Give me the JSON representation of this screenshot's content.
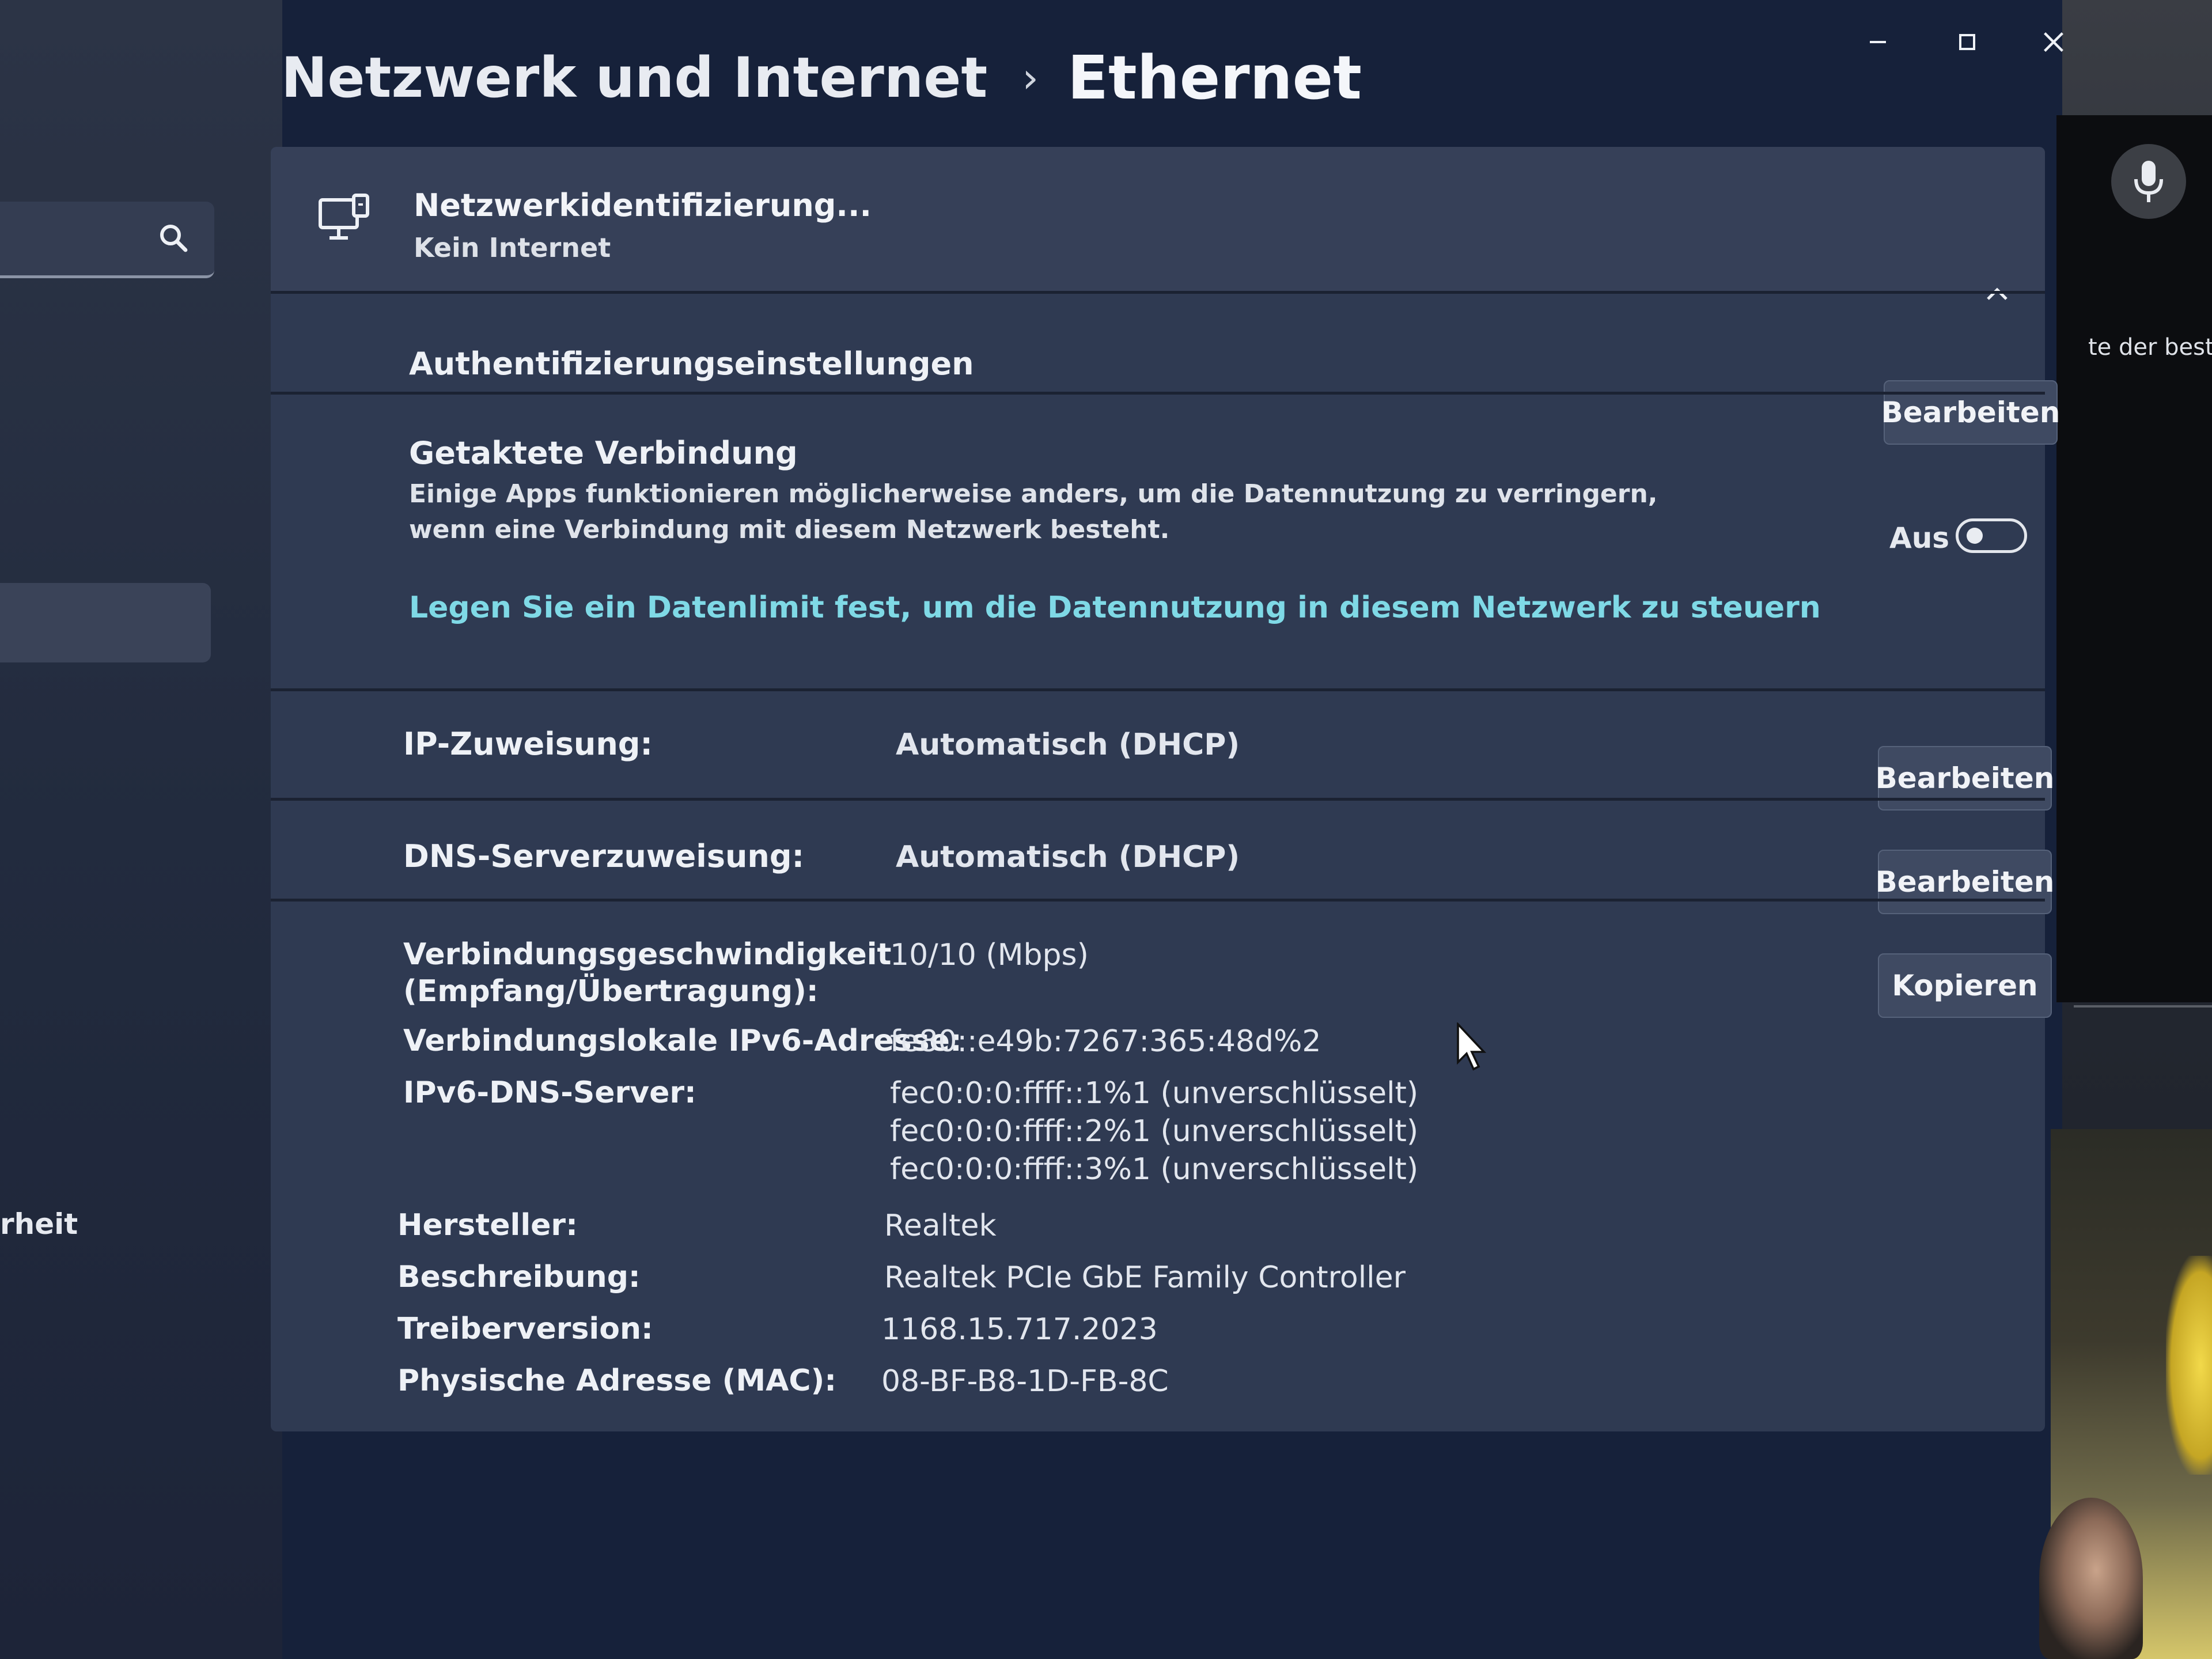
{
  "breadcrumb": {
    "parent": "Netzwerk und Internet",
    "separator": "›",
    "current": "Ethernet"
  },
  "network": {
    "name": "Netzwerkidentifizierung...",
    "status": "Kein Internet"
  },
  "auth": {
    "label": "Authentifizierungseinstellungen",
    "button": "Bearbeiten"
  },
  "metered": {
    "label": "Getaktete Verbindung",
    "description": "Einige Apps funktionieren möglicherweise anders, um die Datennutzung zu verringern, wenn eine Verbindung mit diesem Netzwerk besteht.",
    "toggle_state": "Aus",
    "toggle_on": false,
    "link": "Legen Sie ein Datenlimit fest, um die Datennutzung in diesem Netzwerk zu steuern"
  },
  "ip": {
    "label": "IP-Zuweisung:",
    "value": "Automatisch (DHCP)",
    "button": "Bearbeiten"
  },
  "dns": {
    "label": "DNS-Serverzuweisung:",
    "value": "Automatisch (DHCP)",
    "button": "Bearbeiten"
  },
  "properties": {
    "copy_button": "Kopieren",
    "speed_label_1": "Verbindungsgeschwindigkeit",
    "speed_label_2": "(Empfang/Übertragung):",
    "speed_value": "10/10 (Mbps)",
    "ipv6_label": "Verbindungslokale IPv6-Adresse:",
    "ipv6_value": "fe80::e49b:7267:365:48d%2",
    "ipv6dns_label": "IPv6-DNS-Server:",
    "ipv6dns_values": [
      "fec0:0:0:ffff::1%1 (unverschlüsselt)",
      "fec0:0:0:ffff::2%1 (unverschlüsselt)",
      "fec0:0:0:ffff::3%1 (unverschlüsselt)"
    ],
    "manufacturer_label": "Hersteller:",
    "manufacturer_value": "Realtek",
    "description_label": "Beschreibung:",
    "description_value": "Realtek PCIe GbE Family Controller",
    "driver_label": "Treiberversion:",
    "driver_value": "1168.15.717.2023",
    "mac_label": "Physische Adresse (MAC):",
    "mac_value": "08-BF-B8-1D-FB-8C"
  },
  "sidebar": {
    "partial_item": "rheit"
  },
  "background": {
    "peek_text": "te der beste"
  },
  "icons": {
    "search": "search-icon",
    "network": "network-monitor-icon",
    "collapse": "chevron-up-icon",
    "minimize": "minimize-icon",
    "maximize": "maximize-icon",
    "close": "close-icon",
    "mic": "microphone-icon",
    "cursor": "mouse-pointer-icon"
  },
  "colors": {
    "link": "#7fd9e6",
    "card": "#2f3a52",
    "button": "#3f4a62"
  }
}
